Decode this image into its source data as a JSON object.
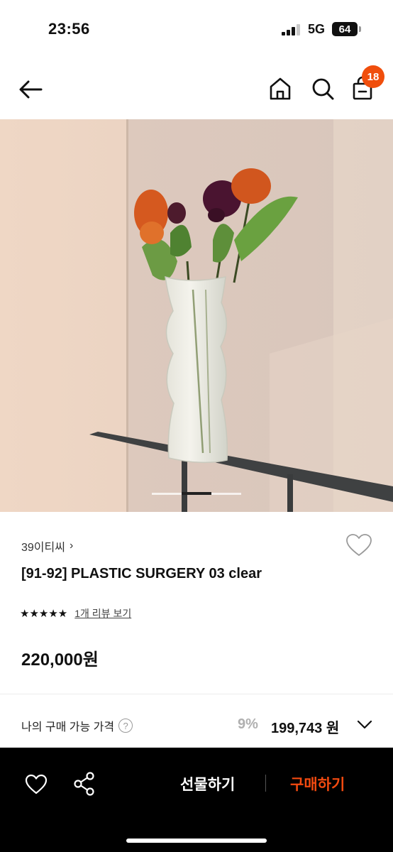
{
  "status_bar": {
    "time": "23:56",
    "network": "5G",
    "battery": "64"
  },
  "nav": {
    "cart_count": "18"
  },
  "product": {
    "brand": "39이티씨",
    "brand_chevron": "›",
    "title": "[91-92] PLASTIC SURGERY 03 clear",
    "stars": "★★★★★",
    "rating_value": 5,
    "review_link": "1개 리뷰 보기",
    "price": "220,000원"
  },
  "my_price": {
    "label": "나의 구매 가능 가격",
    "help": "?",
    "discount": "9%",
    "price": "199,743 원"
  },
  "bottom_bar": {
    "gift_label": "선물하기",
    "buy_label": "구매하기"
  },
  "gallery": {
    "current_index": 2,
    "total": 3
  },
  "colors": {
    "accent": "#f04e0c",
    "buy": "#f24a10",
    "bottom_bar_bg": "#000000"
  },
  "icons": [
    "back-arrow-icon",
    "home-icon",
    "search-icon",
    "cart-icon",
    "heart-icon",
    "share-icon",
    "chevron-down-icon",
    "help-icon"
  ]
}
